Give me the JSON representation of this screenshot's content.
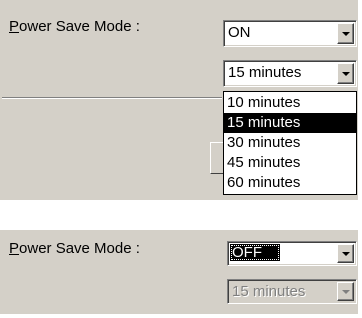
{
  "top_panel": {
    "label": {
      "accel": "P",
      "rest": "ower Save Mode :"
    },
    "mode_select": {
      "value": "ON"
    },
    "timeout_select": {
      "value": "15 minutes"
    },
    "timeout_options": [
      {
        "label": "10 minutes",
        "selected": false
      },
      {
        "label": "15 minutes",
        "selected": true
      },
      {
        "label": "30 minutes",
        "selected": false
      },
      {
        "label": "45 minutes",
        "selected": false
      },
      {
        "label": "60 minutes",
        "selected": false
      }
    ]
  },
  "bottom_panel": {
    "label": {
      "accel": "P",
      "rest": "ower Save Mode :"
    },
    "mode_select": {
      "value": "OFF"
    },
    "timeout_select": {
      "value": "15 minutes",
      "disabled": true
    }
  },
  "colors": {
    "panel": "#d4d0c8",
    "selection": "#000000",
    "disabled_text": "#808080"
  }
}
